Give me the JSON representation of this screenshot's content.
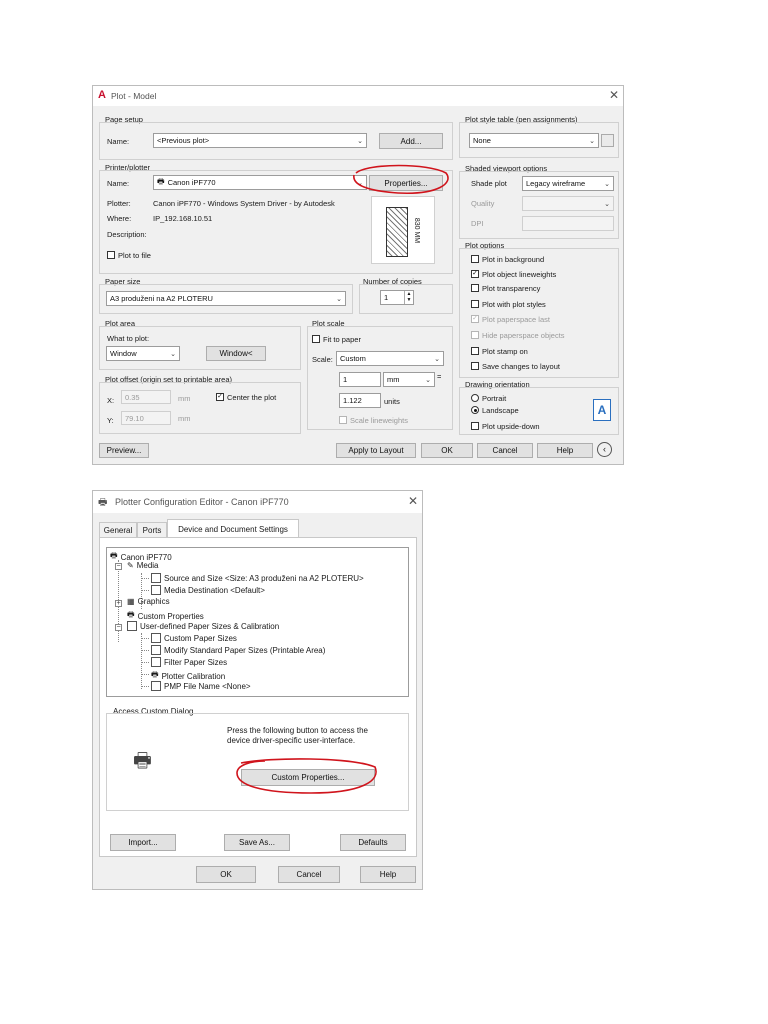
{
  "plot_dialog": {
    "title": "Plot - Model",
    "page_setup": {
      "group": "Page setup",
      "name_label": "Name:",
      "name_value": "<Previous plot>",
      "add_button": "Add..."
    },
    "printer": {
      "group": "Printer/plotter",
      "name_label": "Name:",
      "name_value": "Canon iPF770",
      "properties_button": "Properties...",
      "plotter_label": "Plotter:",
      "plotter_value": "Canon iPF770 - Windows System Driver - by Autodesk",
      "where_label": "Where:",
      "where_value": "IP_192.168.10.51",
      "description_label": "Description:",
      "plot_to_file": "Plot to file",
      "preview_dim": "830 MM"
    },
    "paper_size": {
      "group": "Paper size",
      "value": "A3 produženi na A2 PLOTERU"
    },
    "copies": {
      "group": "Number of copies",
      "value": "1"
    },
    "plot_area": {
      "group": "Plot area",
      "what_label": "What to plot:",
      "what_value": "Window",
      "window_button": "Window<"
    },
    "plot_scale": {
      "group": "Plot scale",
      "fit": "Fit to paper",
      "scale_label": "Scale:",
      "scale_value": "Custom",
      "value1": "1",
      "unit1": "mm",
      "eq": "=",
      "value2": "1.122",
      "unit2": "units",
      "lineweights": "Scale lineweights"
    },
    "plot_offset": {
      "group": "Plot offset (origin set to printable area)",
      "x_label": "X:",
      "x_value": "0.35",
      "x_unit": "mm",
      "y_label": "Y:",
      "y_value": "79.10",
      "y_unit": "mm",
      "center": "Center the plot"
    },
    "style_table": {
      "group": "Plot style table (pen assignments)",
      "value": "None"
    },
    "shaded": {
      "group": "Shaded viewport options",
      "shade_label": "Shade plot",
      "shade_value": "Legacy wireframe",
      "quality_label": "Quality",
      "dpi_label": "DPI"
    },
    "plot_options": {
      "group": "Plot options",
      "items": [
        "Plot in background",
        "Plot object lineweights",
        "Plot transparency",
        "Plot with plot styles",
        "Plot paperspace last",
        "Hide paperspace objects",
        "Plot stamp on",
        "Save changes to layout"
      ]
    },
    "orientation": {
      "group": "Drawing orientation",
      "portrait": "Portrait",
      "landscape": "Landscape",
      "upside": "Plot upside-down"
    },
    "buttons": {
      "preview": "Preview...",
      "apply": "Apply to Layout",
      "ok": "OK",
      "cancel": "Cancel",
      "help": "Help"
    }
  },
  "config_dialog": {
    "title": "Plotter Configuration Editor - Canon iPF770",
    "tabs": [
      "General",
      "Ports",
      "Device and Document Settings"
    ],
    "tree": [
      "Canon iPF770",
      "Media",
      "Source and Size <Size: A3 produženi na A2 PLOTERU>",
      "Media Destination <Default>",
      "Graphics",
      "Custom Properties",
      "User-defined Paper Sizes & Calibration",
      "Custom Paper Sizes",
      "Modify Standard Paper Sizes (Printable Area)",
      "Filter Paper Sizes",
      "Plotter Calibration",
      "PMP File Name <None>"
    ],
    "access_group": "Access Custom Dialog",
    "access_text_1": "Press the following button to access the",
    "access_text_2": "device driver-specific user-interface.",
    "custom_button": "Custom Properties...",
    "buttons": {
      "import": "Import...",
      "save_as": "Save As...",
      "defaults": "Defaults",
      "ok": "OK",
      "cancel": "Cancel",
      "help": "Help"
    }
  },
  "colors": {
    "annotation": "#d0141c",
    "autocad_red": "#c8102e",
    "dialog_bg": "#f0f0f0"
  }
}
